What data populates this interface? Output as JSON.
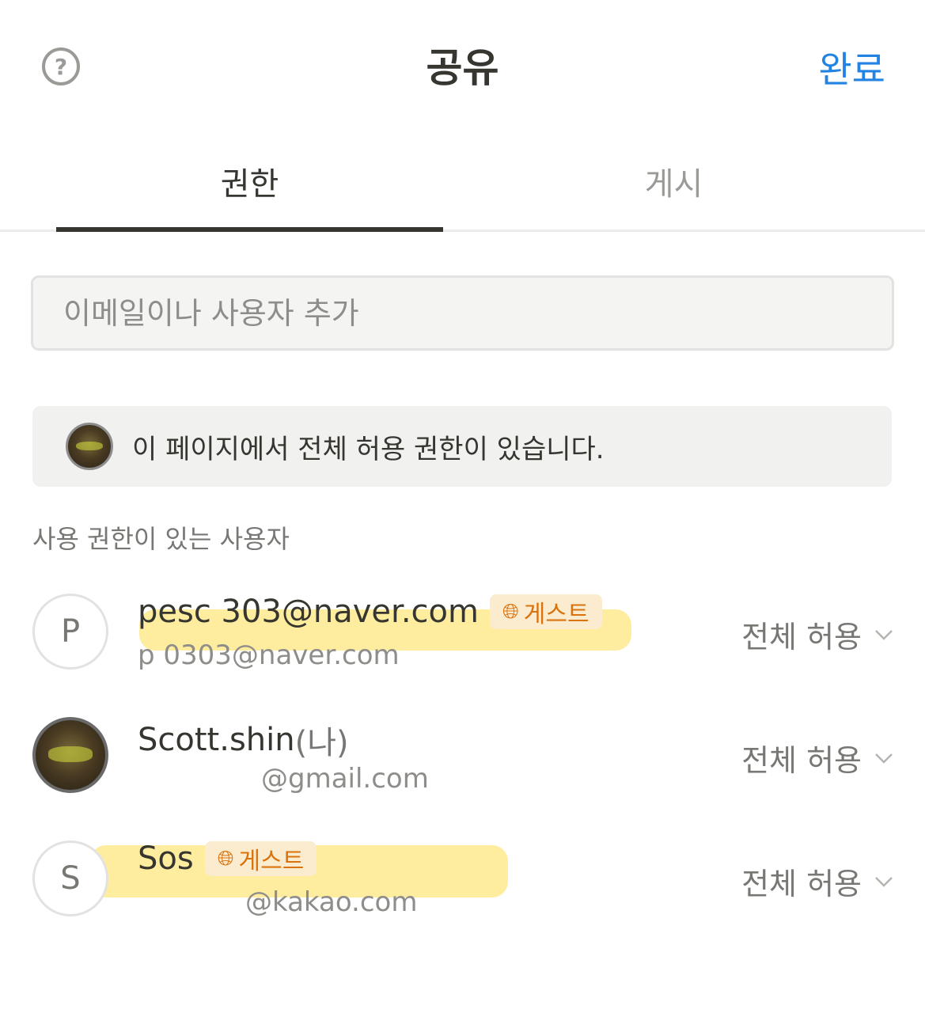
{
  "header": {
    "help_glyph": "?",
    "title": "공유",
    "done_label": "완료"
  },
  "tabs": [
    {
      "label": "권한",
      "active": true
    },
    {
      "label": "게시",
      "active": false
    }
  ],
  "invite": {
    "placeholder": "이메일이나 사용자 추가"
  },
  "notice": {
    "text": "이 페이지에서 전체 허용 권한이 있습니다."
  },
  "section_label": "사용 권한이 있는 사용자",
  "users": [
    {
      "initial": "P",
      "name": "pesc 303@naver.com",
      "guest_label": "게스트",
      "email": "p 0303@naver.com",
      "role": "전체 허용"
    },
    {
      "name": "Scott.shin",
      "me_label": "(나)",
      "email": "@gmail.com",
      "role": "전체 허용"
    },
    {
      "initial": "S",
      "name": "Sos",
      "guest_label": "게스트",
      "email": "@kakao.com",
      "role": "전체 허용"
    }
  ],
  "colors": {
    "accent": "#2383e2",
    "guest_badge_bg": "#fbecd0",
    "guest_badge_text": "#d9730d",
    "highlighter": "#ffde50"
  }
}
